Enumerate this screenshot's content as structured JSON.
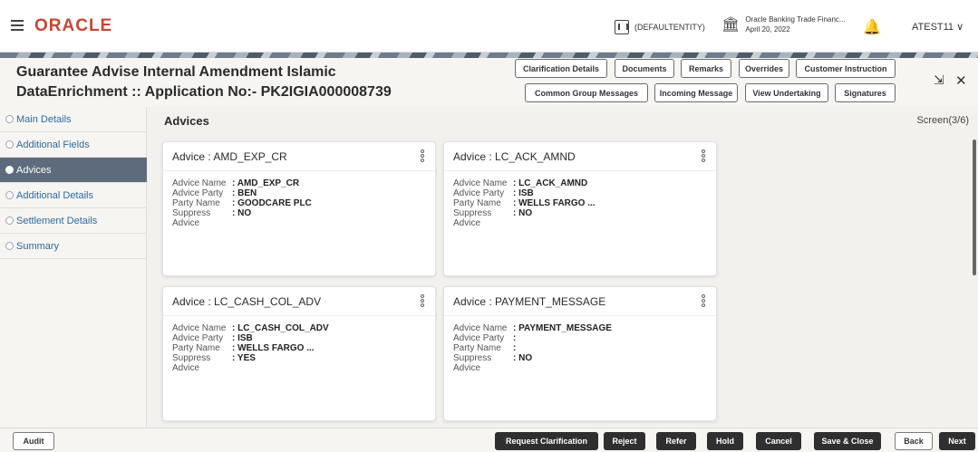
{
  "header": {
    "brand": "ORACLE",
    "entity": "(DEFAULTENTITY)",
    "bank_name": "Oracle Banking Trade Financ...",
    "bank_date": "April 20, 2022",
    "user": "ATEST11"
  },
  "page": {
    "title_line1": "Guarantee Advise Internal Amendment Islamic",
    "title_line2": "DataEnrichment :: Application No:- PK2IGIA000008739"
  },
  "header_buttons": [
    {
      "label": "Clarification Details"
    },
    {
      "label": "Documents"
    },
    {
      "label": "Remarks"
    },
    {
      "label": "Overrides"
    },
    {
      "label": "Customer Instruction"
    },
    {
      "label": "Common Group Messages"
    },
    {
      "label": "Incoming Message"
    },
    {
      "label": "View Undertaking"
    },
    {
      "label": "Signatures"
    }
  ],
  "sidebar": {
    "items": [
      {
        "label": "Main Details"
      },
      {
        "label": "Additional Fields"
      },
      {
        "label": "Advices"
      },
      {
        "label": "Additional Details"
      },
      {
        "label": "Settlement Details"
      },
      {
        "label": "Summary"
      }
    ]
  },
  "main": {
    "section_title": "Advices",
    "screen_indicator": "Screen(3/6)",
    "field_labels": {
      "name": "Advice Name",
      "party": "Advice Party",
      "party_name": "Party Name",
      "suppress": "Suppress Advice"
    },
    "cards": [
      {
        "title": "Advice : AMD_EXP_CR",
        "name": ": AMD_EXP_CR",
        "party": ": BEN",
        "party_name": ": GOODCARE PLC",
        "suppress": ": NO"
      },
      {
        "title": "Advice : LC_ACK_AMND",
        "name": ": LC_ACK_AMND",
        "party": ": ISB",
        "party_name": ": WELLS FARGO ...",
        "suppress": ": NO"
      },
      {
        "title": "Advice : LC_CASH_COL_ADV",
        "name": ": LC_CASH_COL_ADV",
        "party": ": ISB",
        "party_name": ": WELLS FARGO ...",
        "suppress": ": YES"
      },
      {
        "title": "Advice : PAYMENT_MESSAGE",
        "name": ": PAYMENT_MESSAGE",
        "party": ":",
        "party_name": ":",
        "suppress": ": NO"
      }
    ]
  },
  "footer": {
    "audit": "Audit",
    "request_clarification": "Request Clarification",
    "reject": "Reject",
    "refer": "Refer",
    "hold": "Hold",
    "cancel": "Cancel",
    "save_close": "Save & Close",
    "back": "Back",
    "next": "Next"
  },
  "colors": {
    "brand": "#c74634",
    "active_nav": "#5e6b7d",
    "primary_button": "#2f2f2f"
  }
}
